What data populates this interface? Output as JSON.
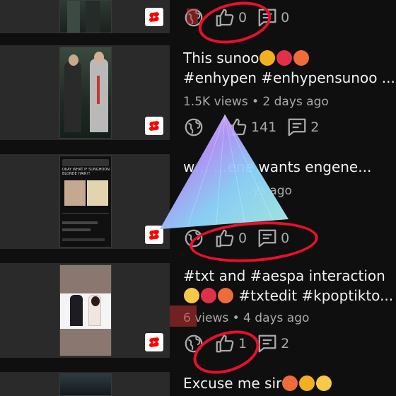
{
  "videos": [
    {
      "title_line1": "",
      "title_line2": "",
      "meta": "",
      "likes": "0",
      "comments": "0"
    },
    {
      "title_line1": "This sunoo",
      "title_line2": "#enhypen #enhypensunoo ...",
      "meta": "1.5K views • 2 days ago",
      "likes": "141",
      "comments": "2",
      "title_emojis": [
        "pinched-fingers",
        "heart-on-fire",
        "hot-face"
      ]
    },
    {
      "title_line1": "w… …ene wants engene...",
      "meta": "…ys ago",
      "likes": "0",
      "comments": "0",
      "thumb_text": "OKAY WHAT IF SUNGHOON BLONDE HAIR?!"
    },
    {
      "title_line1": "#txt and  #aespa interaction",
      "title_line2": "#txtedit #kpoptikto...",
      "meta": "6 views • 4 days ago",
      "likes": "1",
      "comments": "2",
      "title_emojis": [
        "smiling-face",
        "heart-on-fire",
        "hot-face"
      ]
    },
    {
      "title_line1": "Excuse me sir",
      "title_emojis": [
        "hot-face",
        "pinched-fingers",
        "smiling-face"
      ]
    }
  ],
  "icons": {
    "share": "globe-share-icon",
    "like": "thumbs-up-icon",
    "comment": "comment-icon",
    "shorts": "youtube-shorts-icon"
  },
  "colors": {
    "background": "#0f0f0f",
    "text": "#f1f1f1",
    "secondary": "#aaaaaa",
    "shorts_red": "#ff0000",
    "annotation_red": "#e8102a"
  }
}
